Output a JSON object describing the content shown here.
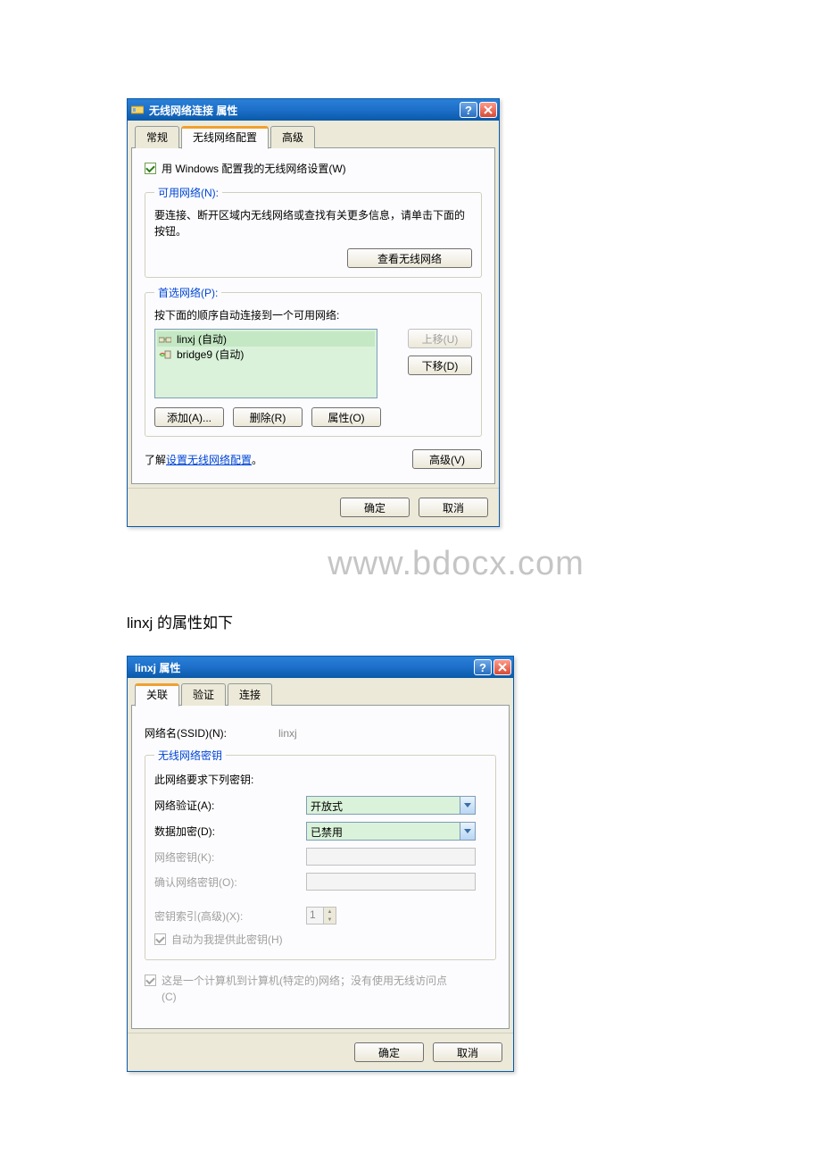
{
  "dialog1": {
    "title": "无线网络连接 属性",
    "tabs": {
      "general": "常规",
      "wireless": "无线网络配置",
      "advanced": "高级"
    },
    "use_windows_cfg": "用 Windows 配置我的无线网络设置(W)",
    "available": {
      "legend": "可用网络(N):",
      "text": "要连接、断开区域内无线网络或查找有关更多信息，请单击下面的按钮。",
      "view_btn": "查看无线网络"
    },
    "preferred": {
      "legend": "首选网络(P):",
      "text": "按下面的顺序自动连接到一个可用网络:",
      "items": [
        {
          "label": "linxj (自动)",
          "type": "adhoc"
        },
        {
          "label": "bridge9 (自动)",
          "type": "infra"
        }
      ],
      "up": "上移(U)",
      "down": "下移(D)",
      "add": "添加(A)...",
      "remove": "删除(R)",
      "props": "属性(O)"
    },
    "learn_prefix": "了解",
    "learn_link": "设置无线网络配置",
    "learn_suffix": "。",
    "adv_btn": "高级(V)",
    "ok": "确定",
    "cancel": "取消"
  },
  "watermark": "www.bdocx.com",
  "between_text": "linxj 的属性如下",
  "dialog2": {
    "title": "linxj 属性",
    "tabs": {
      "assoc": "关联",
      "auth": "验证",
      "conn": "连接"
    },
    "ssid_label": "网络名(SSID)(N):",
    "ssid_value": "linxj",
    "key_group": {
      "legend": "无线网络密钥",
      "requires": "此网络要求下列密钥:",
      "auth_label": "网络验证(A):",
      "auth_value": "开放式",
      "enc_label": "数据加密(D):",
      "enc_value": "已禁用",
      "key_label": "网络密钥(K):",
      "confirm_label": "确认网络密钥(O):",
      "index_label": "密钥索引(高级)(X):",
      "index_value": "1",
      "auto_key": "自动为我提供此密钥(H)"
    },
    "adhoc_text": "这是一个计算机到计算机(特定的)网络；没有使用无线访问点(C)",
    "ok": "确定",
    "cancel": "取消"
  }
}
